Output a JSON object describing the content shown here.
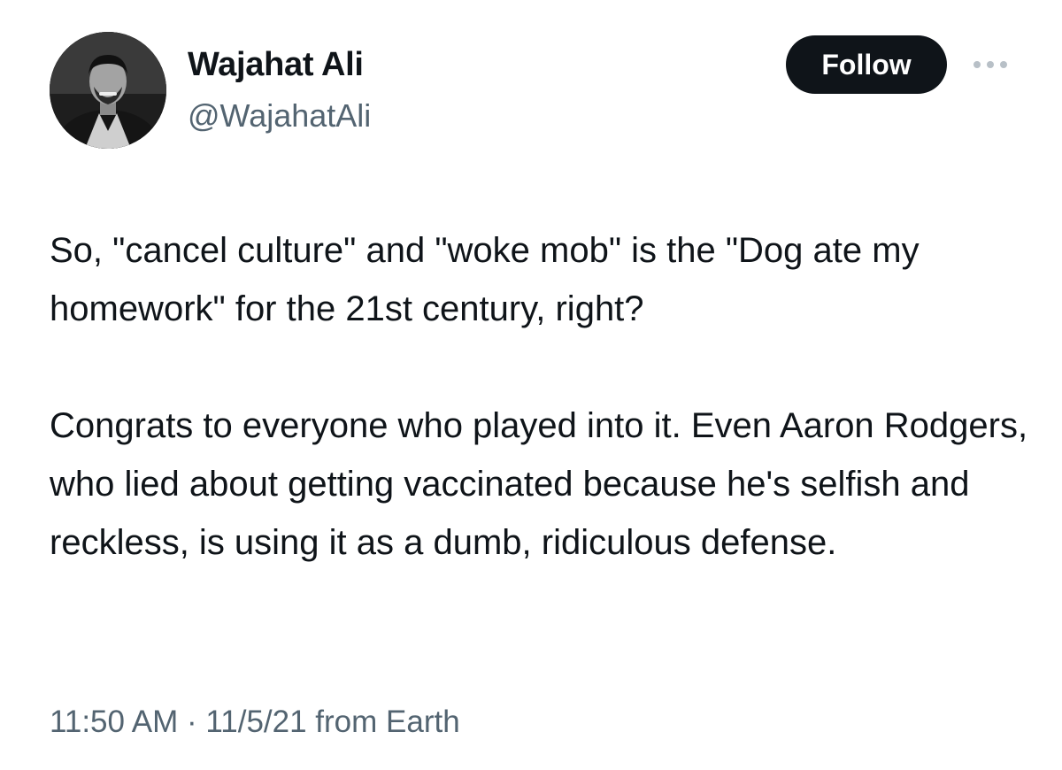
{
  "author": {
    "name": "Wajahat Ali",
    "handle": "@WajahatAli",
    "avatar_icon": "profile-photo"
  },
  "actions": {
    "follow_label": "Follow",
    "more_icon": "more-dots-icon"
  },
  "tweet": {
    "paragraphs": [
      "So, \"cancel culture\" and \"woke mob\" is the \"Dog ate my homework\" for the 21st century, right?",
      "Congrats to everyone who played into it. Even Aaron Rodgers, who lied about getting vaccinated because he's selfish and reckless, is using it as a dumb, ridiculous defense."
    ]
  },
  "meta": {
    "timestamp": "11:50 AM · 11/5/21 from Earth"
  },
  "colors": {
    "text_primary": "#0f1419",
    "text_secondary": "#536471",
    "button_bg": "#0f1419",
    "button_text": "#ffffff"
  }
}
